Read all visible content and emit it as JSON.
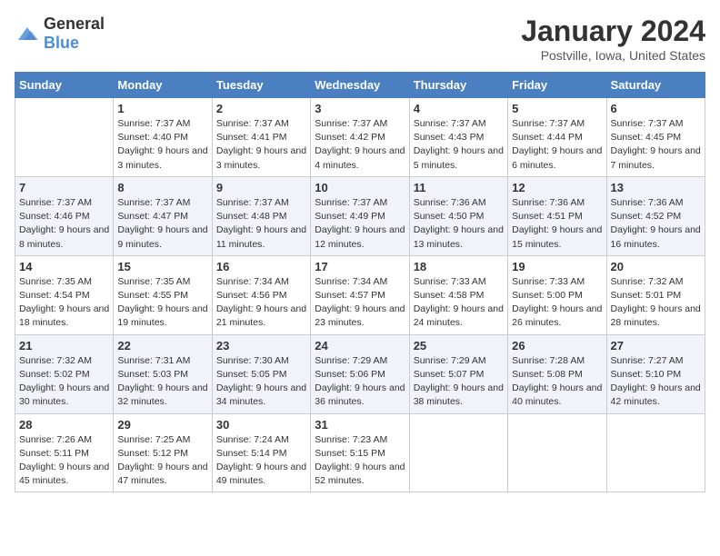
{
  "logo": {
    "general": "General",
    "blue": "Blue"
  },
  "header": {
    "month": "January 2024",
    "location": "Postville, Iowa, United States"
  },
  "weekdays": [
    "Sunday",
    "Monday",
    "Tuesday",
    "Wednesday",
    "Thursday",
    "Friday",
    "Saturday"
  ],
  "weeks": [
    [
      {
        "day": "",
        "sunrise": "",
        "sunset": "",
        "daylight": ""
      },
      {
        "day": "1",
        "sunrise": "Sunrise: 7:37 AM",
        "sunset": "Sunset: 4:40 PM",
        "daylight": "Daylight: 9 hours and 3 minutes."
      },
      {
        "day": "2",
        "sunrise": "Sunrise: 7:37 AM",
        "sunset": "Sunset: 4:41 PM",
        "daylight": "Daylight: 9 hours and 3 minutes."
      },
      {
        "day": "3",
        "sunrise": "Sunrise: 7:37 AM",
        "sunset": "Sunset: 4:42 PM",
        "daylight": "Daylight: 9 hours and 4 minutes."
      },
      {
        "day": "4",
        "sunrise": "Sunrise: 7:37 AM",
        "sunset": "Sunset: 4:43 PM",
        "daylight": "Daylight: 9 hours and 5 minutes."
      },
      {
        "day": "5",
        "sunrise": "Sunrise: 7:37 AM",
        "sunset": "Sunset: 4:44 PM",
        "daylight": "Daylight: 9 hours and 6 minutes."
      },
      {
        "day": "6",
        "sunrise": "Sunrise: 7:37 AM",
        "sunset": "Sunset: 4:45 PM",
        "daylight": "Daylight: 9 hours and 7 minutes."
      }
    ],
    [
      {
        "day": "7",
        "sunrise": "Sunrise: 7:37 AM",
        "sunset": "Sunset: 4:46 PM",
        "daylight": "Daylight: 9 hours and 8 minutes."
      },
      {
        "day": "8",
        "sunrise": "Sunrise: 7:37 AM",
        "sunset": "Sunset: 4:47 PM",
        "daylight": "Daylight: 9 hours and 9 minutes."
      },
      {
        "day": "9",
        "sunrise": "Sunrise: 7:37 AM",
        "sunset": "Sunset: 4:48 PM",
        "daylight": "Daylight: 9 hours and 11 minutes."
      },
      {
        "day": "10",
        "sunrise": "Sunrise: 7:37 AM",
        "sunset": "Sunset: 4:49 PM",
        "daylight": "Daylight: 9 hours and 12 minutes."
      },
      {
        "day": "11",
        "sunrise": "Sunrise: 7:36 AM",
        "sunset": "Sunset: 4:50 PM",
        "daylight": "Daylight: 9 hours and 13 minutes."
      },
      {
        "day": "12",
        "sunrise": "Sunrise: 7:36 AM",
        "sunset": "Sunset: 4:51 PM",
        "daylight": "Daylight: 9 hours and 15 minutes."
      },
      {
        "day": "13",
        "sunrise": "Sunrise: 7:36 AM",
        "sunset": "Sunset: 4:52 PM",
        "daylight": "Daylight: 9 hours and 16 minutes."
      }
    ],
    [
      {
        "day": "14",
        "sunrise": "Sunrise: 7:35 AM",
        "sunset": "Sunset: 4:54 PM",
        "daylight": "Daylight: 9 hours and 18 minutes."
      },
      {
        "day": "15",
        "sunrise": "Sunrise: 7:35 AM",
        "sunset": "Sunset: 4:55 PM",
        "daylight": "Daylight: 9 hours and 19 minutes."
      },
      {
        "day": "16",
        "sunrise": "Sunrise: 7:34 AM",
        "sunset": "Sunset: 4:56 PM",
        "daylight": "Daylight: 9 hours and 21 minutes."
      },
      {
        "day": "17",
        "sunrise": "Sunrise: 7:34 AM",
        "sunset": "Sunset: 4:57 PM",
        "daylight": "Daylight: 9 hours and 23 minutes."
      },
      {
        "day": "18",
        "sunrise": "Sunrise: 7:33 AM",
        "sunset": "Sunset: 4:58 PM",
        "daylight": "Daylight: 9 hours and 24 minutes."
      },
      {
        "day": "19",
        "sunrise": "Sunrise: 7:33 AM",
        "sunset": "Sunset: 5:00 PM",
        "daylight": "Daylight: 9 hours and 26 minutes."
      },
      {
        "day": "20",
        "sunrise": "Sunrise: 7:32 AM",
        "sunset": "Sunset: 5:01 PM",
        "daylight": "Daylight: 9 hours and 28 minutes."
      }
    ],
    [
      {
        "day": "21",
        "sunrise": "Sunrise: 7:32 AM",
        "sunset": "Sunset: 5:02 PM",
        "daylight": "Daylight: 9 hours and 30 minutes."
      },
      {
        "day": "22",
        "sunrise": "Sunrise: 7:31 AM",
        "sunset": "Sunset: 5:03 PM",
        "daylight": "Daylight: 9 hours and 32 minutes."
      },
      {
        "day": "23",
        "sunrise": "Sunrise: 7:30 AM",
        "sunset": "Sunset: 5:05 PM",
        "daylight": "Daylight: 9 hours and 34 minutes."
      },
      {
        "day": "24",
        "sunrise": "Sunrise: 7:29 AM",
        "sunset": "Sunset: 5:06 PM",
        "daylight": "Daylight: 9 hours and 36 minutes."
      },
      {
        "day": "25",
        "sunrise": "Sunrise: 7:29 AM",
        "sunset": "Sunset: 5:07 PM",
        "daylight": "Daylight: 9 hours and 38 minutes."
      },
      {
        "day": "26",
        "sunrise": "Sunrise: 7:28 AM",
        "sunset": "Sunset: 5:08 PM",
        "daylight": "Daylight: 9 hours and 40 minutes."
      },
      {
        "day": "27",
        "sunrise": "Sunrise: 7:27 AM",
        "sunset": "Sunset: 5:10 PM",
        "daylight": "Daylight: 9 hours and 42 minutes."
      }
    ],
    [
      {
        "day": "28",
        "sunrise": "Sunrise: 7:26 AM",
        "sunset": "Sunset: 5:11 PM",
        "daylight": "Daylight: 9 hours and 45 minutes."
      },
      {
        "day": "29",
        "sunrise": "Sunrise: 7:25 AM",
        "sunset": "Sunset: 5:12 PM",
        "daylight": "Daylight: 9 hours and 47 minutes."
      },
      {
        "day": "30",
        "sunrise": "Sunrise: 7:24 AM",
        "sunset": "Sunset: 5:14 PM",
        "daylight": "Daylight: 9 hours and 49 minutes."
      },
      {
        "day": "31",
        "sunrise": "Sunrise: 7:23 AM",
        "sunset": "Sunset: 5:15 PM",
        "daylight": "Daylight: 9 hours and 52 minutes."
      },
      {
        "day": "",
        "sunrise": "",
        "sunset": "",
        "daylight": ""
      },
      {
        "day": "",
        "sunrise": "",
        "sunset": "",
        "daylight": ""
      },
      {
        "day": "",
        "sunrise": "",
        "sunset": "",
        "daylight": ""
      }
    ]
  ]
}
